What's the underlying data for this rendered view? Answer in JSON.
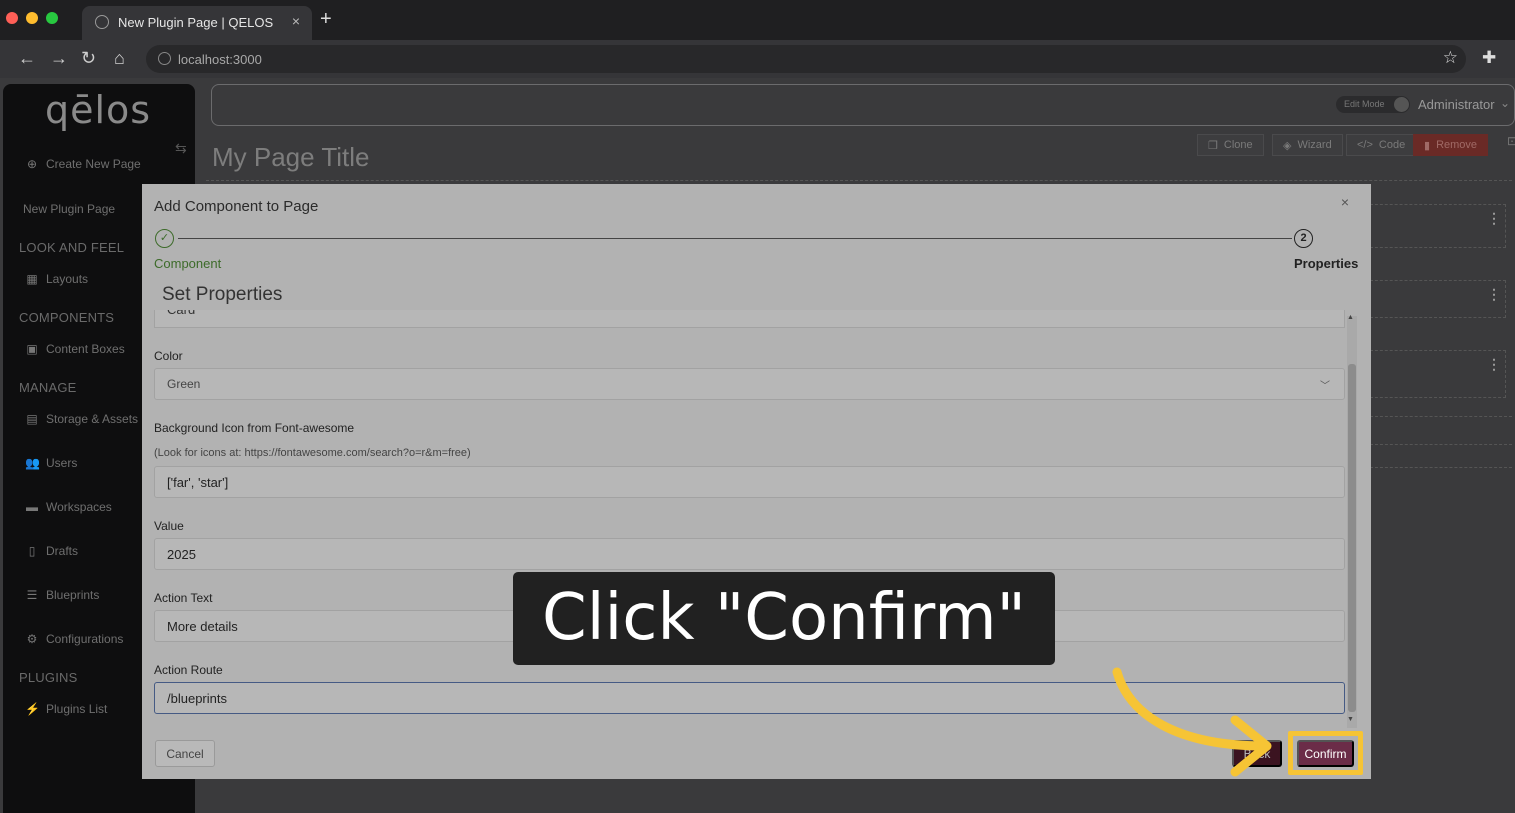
{
  "browser": {
    "tab_title": "New Plugin Page | QELOS",
    "tab_close": "×",
    "new_tab": "+",
    "url": "localhost:3000",
    "nav": {
      "back": "←",
      "forward": "→",
      "reload": "↻",
      "home": "⌂"
    },
    "bookmark_icon": "☆",
    "extensions_icon": "✚"
  },
  "sidebar": {
    "logo": "qēlos",
    "create_new_page": "Create New Page",
    "current_page": "New Plugin Page",
    "sections": {
      "look_and_feel": "LOOK AND FEEL",
      "components": "COMPONENTS",
      "manage": "MANAGE",
      "plugins": "PLUGINS"
    },
    "items": {
      "layouts": "Layouts",
      "content_boxes": "Content Boxes",
      "storage_assets": "Storage & Assets",
      "users": "Users",
      "workspaces": "Workspaces",
      "drafts": "Drafts",
      "blueprints": "Blueprints",
      "configurations": "Configurations",
      "plugins_list": "Plugins List"
    }
  },
  "header": {
    "edit_mode": "Edit Mode",
    "user": "Administrator"
  },
  "page": {
    "title": "My Page Title",
    "actions": {
      "clone": "Clone",
      "wizard": "Wizard",
      "code": "Code",
      "remove": "Remove"
    }
  },
  "modal": {
    "title": "Add Component to Page",
    "close": "×",
    "steps": [
      {
        "number": "✓",
        "label": "Component",
        "state": "done"
      },
      {
        "number": "2",
        "label": "Properties",
        "state": "active"
      }
    ],
    "section_title": "Set Properties",
    "partial_field_value": "Card",
    "fields": {
      "color": {
        "label": "Color",
        "value": "Green"
      },
      "bg_icon": {
        "label": "Background Icon from Font-awesome",
        "hint": "(Look for icons at: https://fontawesome.com/search?o=r&m=free)",
        "value": "['far', 'star']"
      },
      "value": {
        "label": "Value",
        "value": "2025"
      },
      "action_text": {
        "label": "Action Text",
        "value": "More details"
      },
      "action_route": {
        "label": "Action Route",
        "value": "/blueprints"
      }
    },
    "buttons": {
      "cancel": "Cancel",
      "back": "Back",
      "confirm": "Confirm"
    }
  },
  "overlay": {
    "instruction": "Click \"Confirm\"",
    "highlight_color": "#f6c435"
  },
  "colors": {
    "brand": "#6b2c48",
    "success": "#3d6b2a",
    "danger": "#c8372d"
  }
}
